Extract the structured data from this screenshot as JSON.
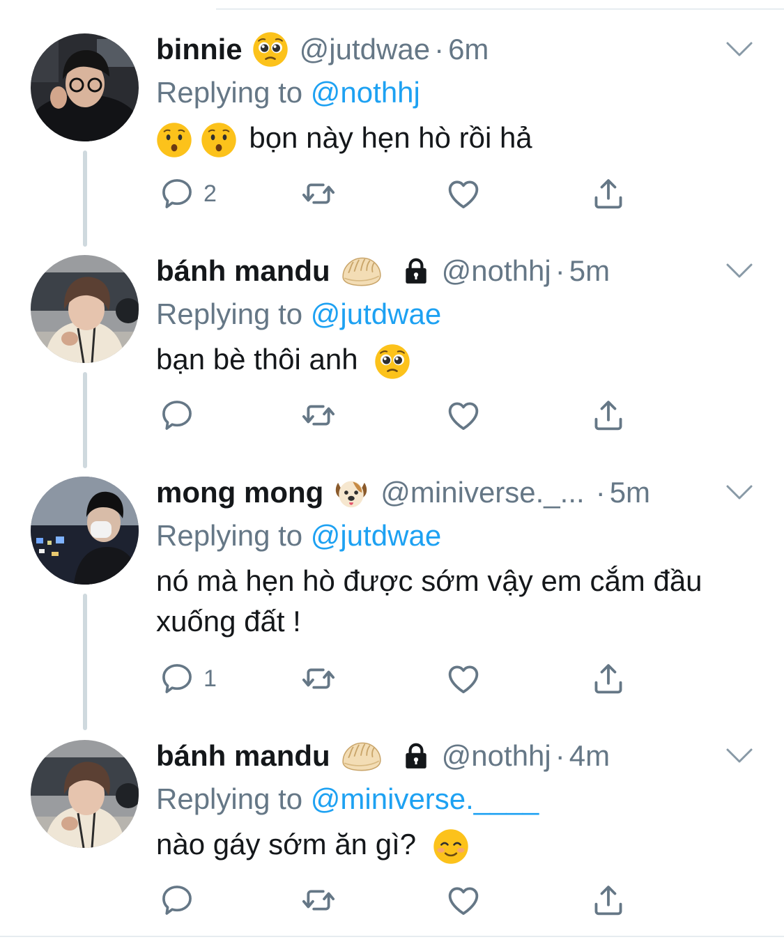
{
  "tweets": [
    {
      "name": "binnie",
      "handle": "@jutdwae",
      "dot": "·",
      "time": "6m",
      "replying_prefix": "Replying to",
      "replying_to": "@nothhj",
      "text": "bọn này hẹn hò rồi hả",
      "reply_count": "2",
      "name_emoji": "pleading-face",
      "text_emoji": [
        "hushed-face",
        "hushed-face"
      ]
    },
    {
      "name": "bánh mandu",
      "handle": "@nothhj",
      "dot": "·",
      "time": "5m",
      "replying_prefix": "Replying to",
      "replying_to": "@jutdwae",
      "text": "bạn bè thôi anh",
      "reply_count": "",
      "name_emoji": "dumpling",
      "protected": true,
      "text_emoji": [
        "pleading-face"
      ]
    },
    {
      "name": "mong mong",
      "handle": "@miniverse._...",
      "dot": "·",
      "time": "5m",
      "replying_prefix": "Replying to",
      "replying_to": "@jutdwae",
      "text": "nó mà hẹn hò được sớm vậy em cắm đầu xuống đất !",
      "reply_count": "1",
      "name_emoji": "dog-face"
    },
    {
      "name": "bánh mandu",
      "handle": "@nothhj",
      "dot": "·",
      "time": "4m",
      "replying_prefix": "Replying to",
      "replying_to": "@miniverse.____",
      "text": "nào gáy sớm ăn gì?",
      "reply_count": "",
      "name_emoji": "dumpling",
      "protected": true,
      "text_emoji": [
        "smiling-face"
      ]
    }
  ],
  "colors": {
    "link": "#1da1f2",
    "secondary_text": "#657786",
    "primary_text": "#14171a",
    "thread_line": "#cfd9de"
  },
  "icons": [
    "reply-icon",
    "retweet-icon",
    "like-icon",
    "share-icon",
    "chevron-down-icon",
    "lock-icon"
  ]
}
